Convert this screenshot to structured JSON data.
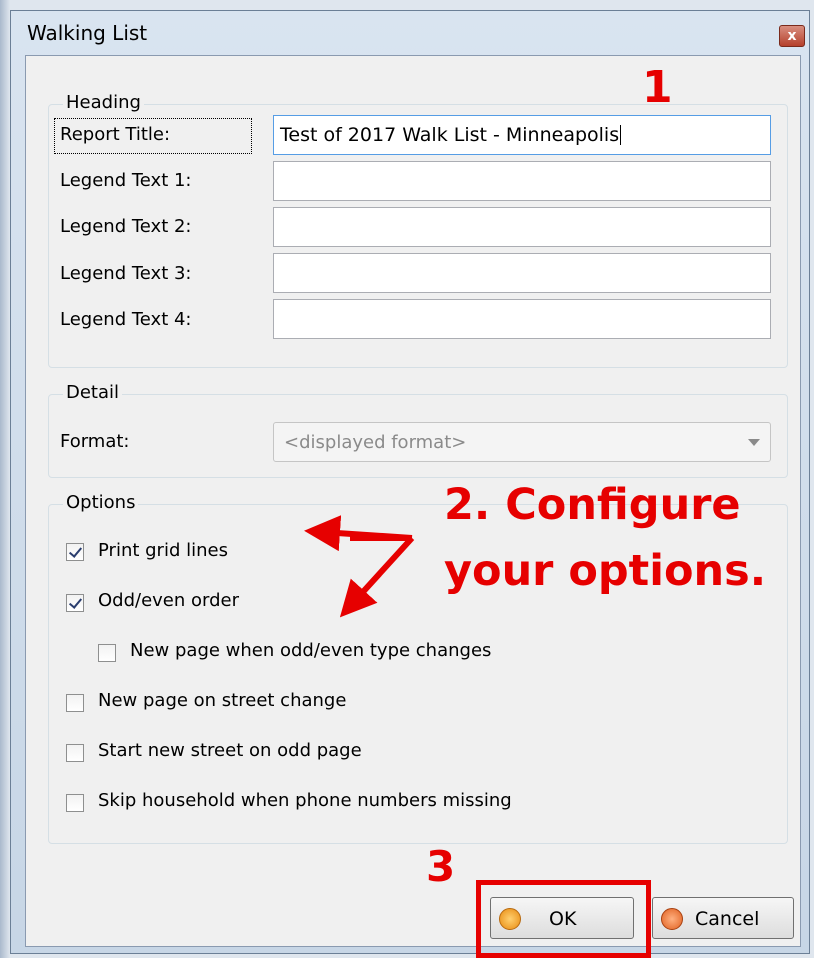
{
  "window": {
    "title": "Walking List",
    "close_glyph": "x"
  },
  "heading": {
    "group_title": "Heading",
    "fields": [
      {
        "label": "Report Title:",
        "value": "Test of 2017 Walk List - Minneapolis"
      },
      {
        "label": "Legend Text 1:",
        "value": ""
      },
      {
        "label": "Legend Text 2:",
        "value": ""
      },
      {
        "label": "Legend Text 3:",
        "value": ""
      },
      {
        "label": "Legend Text 4:",
        "value": ""
      }
    ]
  },
  "detail": {
    "group_title": "Detail",
    "format_label": "Format:",
    "format_value": "<displayed format>"
  },
  "options": {
    "group_title": "Options",
    "items": [
      {
        "label": "Print grid lines",
        "checked": true
      },
      {
        "label": "Odd/even order",
        "checked": true
      },
      {
        "label": "New page when odd/even type changes",
        "checked": false
      },
      {
        "label": "New page on street change",
        "checked": false
      },
      {
        "label": "Start new street on odd page",
        "checked": false
      },
      {
        "label": "Skip household when phone numbers missing",
        "checked": false
      }
    ]
  },
  "buttons": {
    "ok": "OK",
    "cancel": "Cancel"
  },
  "annotations": {
    "step1": "1",
    "step2_line1": "2. Configure",
    "step2_line2": "your options.",
    "step3": "3",
    "color": "#e60000"
  },
  "colors": {
    "ok_icon": "#f0a020",
    "cancel_icon": "#f07a30"
  }
}
